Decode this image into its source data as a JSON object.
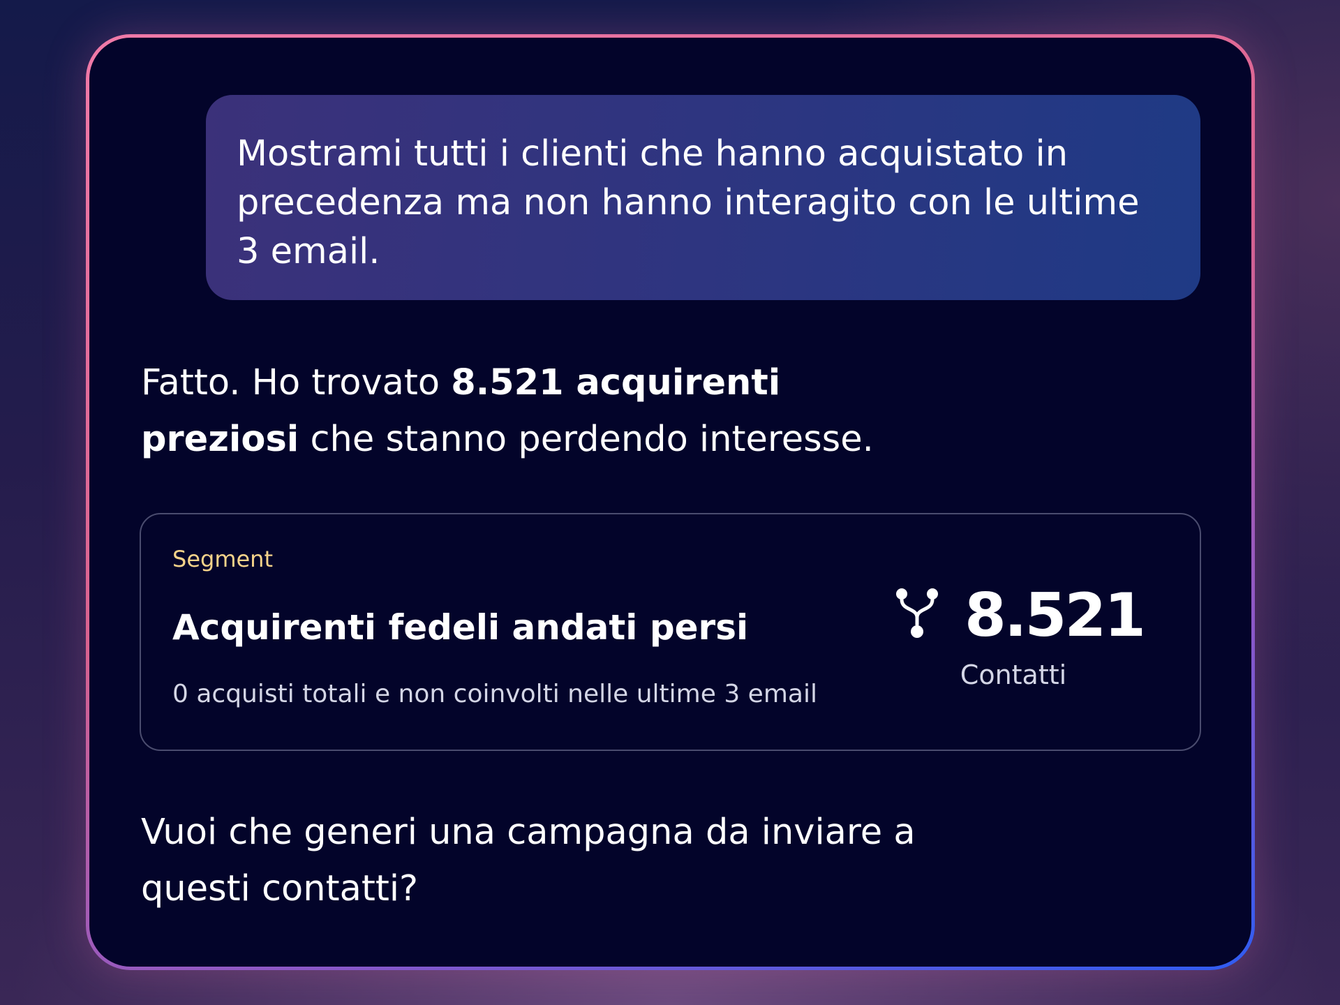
{
  "chat": {
    "user_message": "Mostrami tutti i clienti che hanno acquistato in precedenza ma non hanno interagito con le ultime 3 email.",
    "reply": {
      "prefix": "Fatto. Ho trovato ",
      "highlight": "8.521 acquirenti preziosi",
      "suffix": " che stanno perdendo interesse."
    },
    "question": "Vuoi che generi una campagna da inviare a questi contatti?"
  },
  "segment_card": {
    "kicker": "Segment",
    "title": "Acquirenti fedeli andati persi",
    "description": "0 acquisti totali e non coinvolti nelle ultime 3 email",
    "icon": "segment-merge-icon",
    "count": "8.521",
    "count_label": "Contatti"
  },
  "colors": {
    "panel_background": "#03042a",
    "bubble_gradient_start": "#3b317a",
    "bubble_gradient_end": "#1f3a85",
    "frame_pink": "#f07aa8",
    "frame_blue": "#2f5cf2",
    "kicker": "#f5d38a",
    "card_border": "#4a4c6e"
  }
}
